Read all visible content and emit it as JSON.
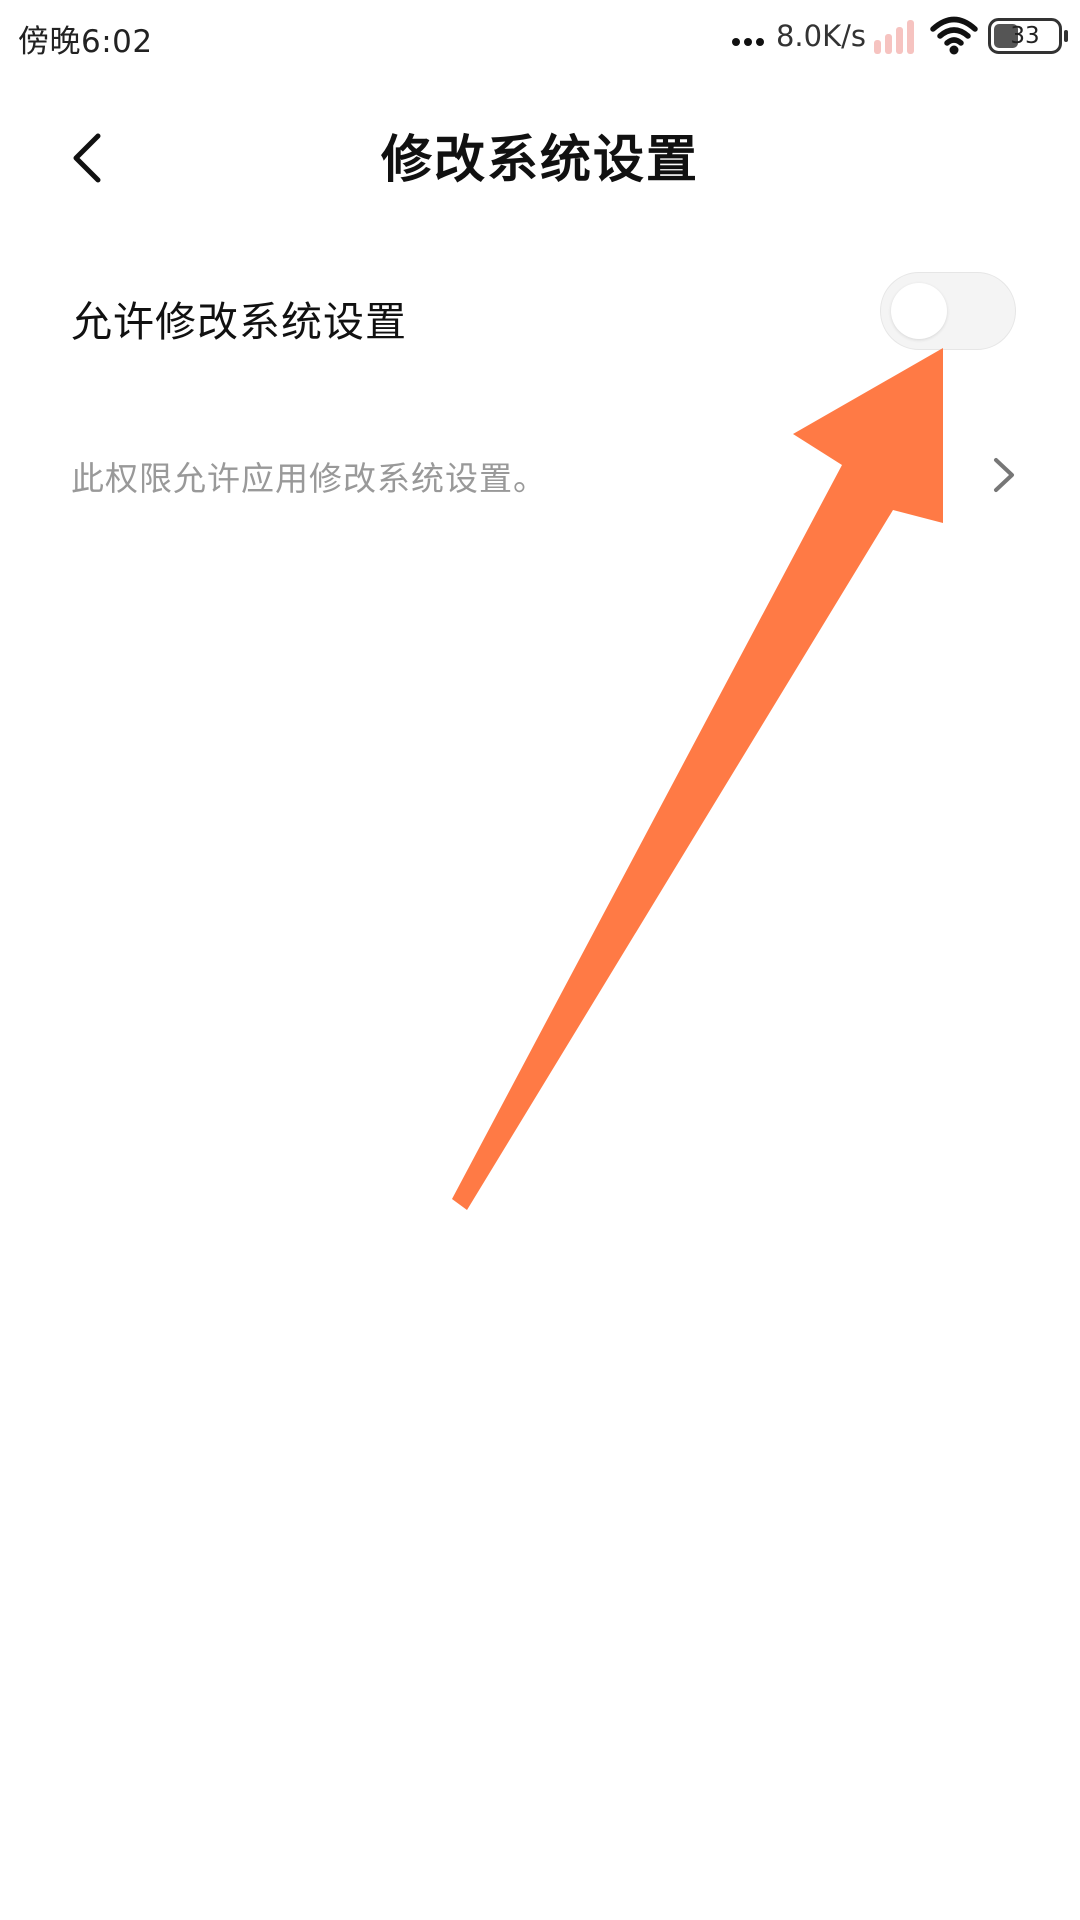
{
  "status_bar": {
    "time": "傍晚6:02",
    "net_speed": "8.0K/s",
    "battery": "33",
    "icons": [
      "more-dots-icon",
      "signal-icon",
      "wifi-icon",
      "battery-icon"
    ]
  },
  "header": {
    "title": "修改系统设置",
    "back_icon": "chevron-left-icon"
  },
  "setting": {
    "label": "允许修改系统设置",
    "toggle_on": false,
    "description": "此权限允许应用修改系统设置。",
    "description_icon": "chevron-right-icon"
  },
  "colors": {
    "arrow": "#FF7A45",
    "toggle_track": "#F4F4F4",
    "secondary_text": "#999999",
    "signal_bars": "#F6C3C0"
  }
}
